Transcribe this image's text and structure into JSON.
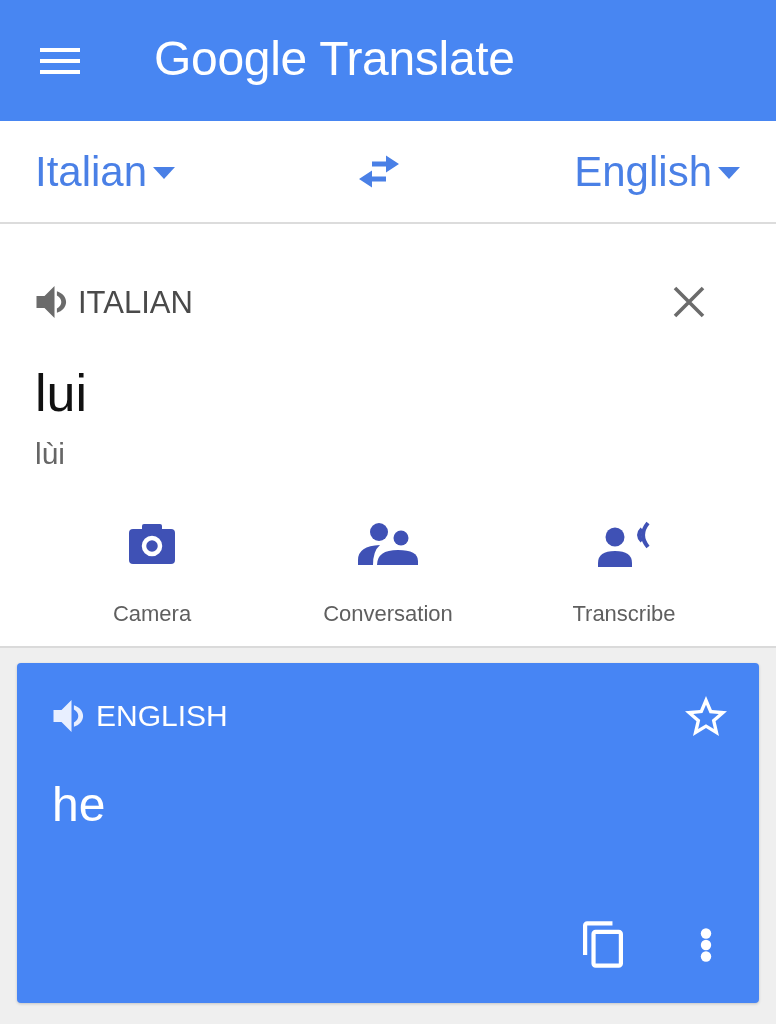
{
  "app_bar": {
    "title": "Google Translate"
  },
  "language_bar": {
    "source": "Italian",
    "target": "English"
  },
  "source_panel": {
    "language": "ITALIAN",
    "text": "lui",
    "transliteration": "lùi",
    "actions": [
      {
        "kind": "camera",
        "label": "Camera"
      },
      {
        "kind": "conversation",
        "label": "Conversation"
      },
      {
        "kind": "transcribe",
        "label": "Transcribe"
      }
    ]
  },
  "result_card": {
    "language": "ENGLISH",
    "text": "he",
    "starred": false
  }
}
